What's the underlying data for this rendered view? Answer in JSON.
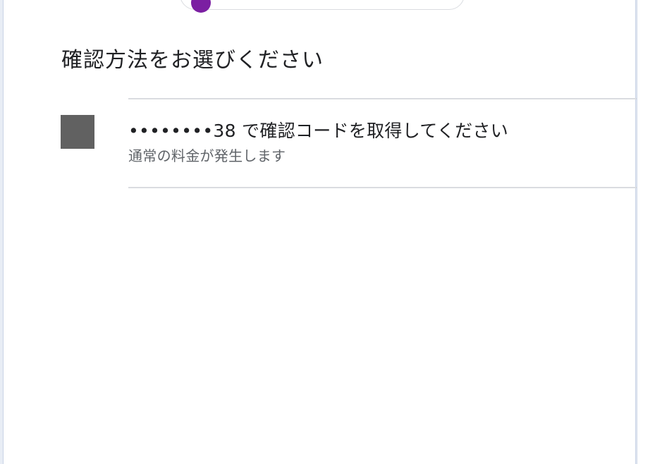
{
  "heading": "確認方法をお選びください",
  "options": [
    {
      "title": "••••••••38 で確認コードを取得してください",
      "subtitle": "通常の料金が発生します",
      "icon": "phone-icon"
    }
  ],
  "colors": {
    "avatar": "#7b1fa2",
    "option_icon": "#616161",
    "divider": "#dadce0"
  }
}
